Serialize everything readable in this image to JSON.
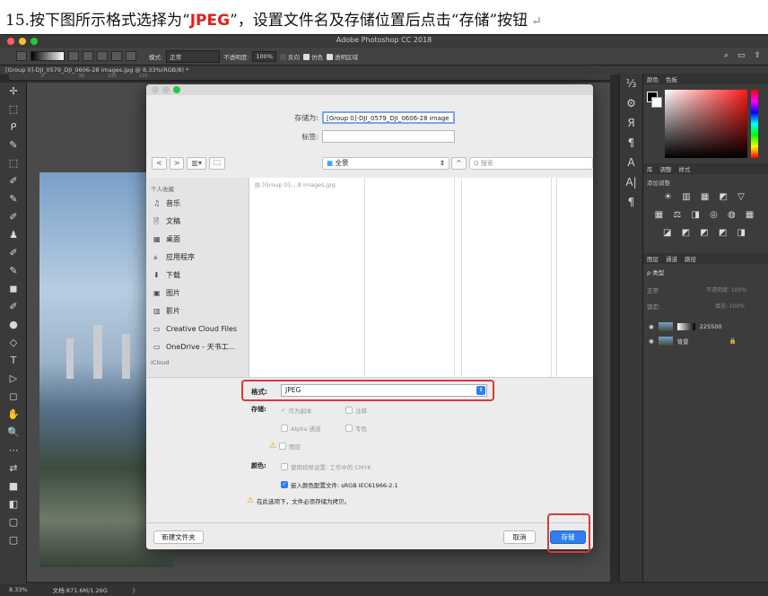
{
  "instruction": {
    "prefix": "15.按下图所示格式选择为“",
    "highlight": "JPEG",
    "suffix": "”，设置文件名及存储位置后点击“存储”按钮",
    "return_mark": "↵"
  },
  "app": {
    "title": "Adobe Photoshop CC 2018",
    "doc_tab": "[Group 0]-DJI_0579_DJI_0606-28 images.jpg @ 8.33%(RGB/8) *",
    "options": {
      "mode_label": "模式:",
      "mode_value": "正常",
      "opacity_label": "不透明度:",
      "opacity_value": "100%",
      "reverse": "反向",
      "dither": "仿色",
      "transparency": "透明区域"
    },
    "ruler": [
      "0",
      "50",
      "100",
      "150"
    ],
    "status": {
      "zoom": "8.33%",
      "doc": "文档:871.6M/1.26G",
      "arrow": "〉"
    }
  },
  "tools": [
    "✢",
    "⬚",
    "ᑭ",
    "✎",
    "⬚",
    "✐",
    "✎",
    "✐",
    "♟",
    "✐",
    "✎",
    "◼",
    "✐",
    "●",
    "◇",
    "T",
    "▷",
    "◻",
    "✋",
    "🔍",
    "⋯",
    "⇄",
    "■",
    "◧",
    "▢",
    "▢"
  ],
  "panels": {
    "color_tabs": [
      "颜色",
      "色板"
    ],
    "adjust_tabs": [
      "库",
      "调整",
      "样式"
    ],
    "add_adjustment": "添加调整",
    "adj_rows": [
      "☀ ▥ ▦ ◩ ▽",
      "▦ ⚖ ◨ ◎ ◍ ▦",
      "◪ ◩ ◩ ◩ ◨"
    ],
    "layer_tabs": [
      "图层",
      "通道",
      "路径"
    ],
    "kind": "ρ 类型",
    "blend": "正常",
    "opacity": "不透明度: 100%",
    "lock": "锁定:",
    "fill": "填充: 100%",
    "layers": [
      {
        "name": "225500"
      },
      {
        "name": "背景"
      }
    ]
  },
  "dialog": {
    "save_as_label": "存储为:",
    "save_as_value": "[Group 0]-DJI_0579_DJI_0606-28 image",
    "tags_label": "标签:",
    "tags_value": "",
    "back": "<",
    "forward": ">",
    "view": "▥▾",
    "group": "🗀",
    "location": "全景",
    "search_placeholder": "Q 搜索",
    "favorites_header": "个人收藏",
    "sidebar": [
      {
        "icon": "♫",
        "label": "音乐"
      },
      {
        "icon": "🗎",
        "label": "文稿"
      },
      {
        "icon": "▦",
        "label": "桌面"
      },
      {
        "icon": "⩓",
        "label": "应用程序"
      },
      {
        "icon": "⬇",
        "label": "下载"
      },
      {
        "icon": "▣",
        "label": "图片"
      },
      {
        "icon": "▥",
        "label": "影片"
      },
      {
        "icon": "▭",
        "label": "Creative Cloud Files"
      },
      {
        "icon": "▭",
        "label": "OneDrive - 天书工..."
      }
    ],
    "icloud_header": "iCloud",
    "file": "▤ [Group 0]-...8 images.jpg",
    "format_label": "格式:",
    "format_value": "JPEG",
    "save_label": "存储:",
    "save_opts": [
      "作为副本",
      "注释",
      "Alpha 通道",
      "专色",
      "图层"
    ],
    "color_label": "颜色:",
    "proof": "使用校样设置: 工作中的 CMYK",
    "embed": "嵌入颜色配置文件: sRGB IEC61966-2.1",
    "copy_warning": "在此选项下，文件必须存储为拷贝。",
    "new_folder": "新建文件夹",
    "cancel": "取消",
    "save": "存储"
  }
}
